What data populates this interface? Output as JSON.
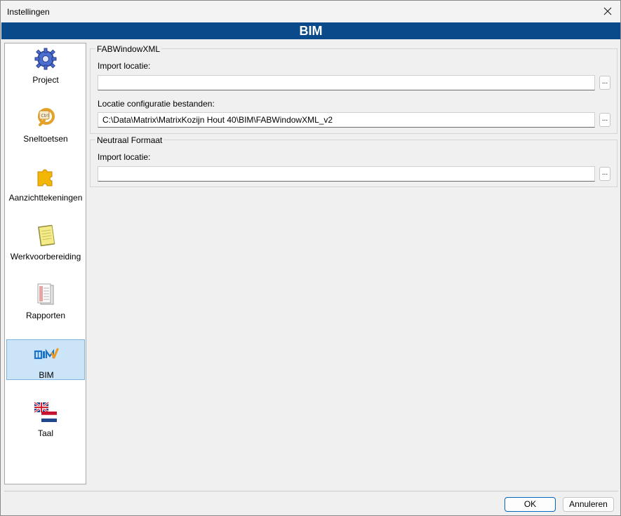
{
  "window": {
    "title": "Instellingen"
  },
  "banner": {
    "title": "BIM"
  },
  "sidebar": {
    "items": [
      {
        "label": "Project",
        "icon": "gear-icon"
      },
      {
        "label": "Sneltoetsen",
        "icon": "keyboard-key-icon"
      },
      {
        "label": "Aanzichttekeningen",
        "icon": "puzzle-icon"
      },
      {
        "label": "Werkvoorbereiding",
        "icon": "notepad-icon"
      },
      {
        "label": "Rapporten",
        "icon": "report-icon"
      },
      {
        "label": "BIM",
        "icon": "bim-logo-icon",
        "selected": true
      },
      {
        "label": "Taal",
        "icon": "flags-icon"
      }
    ]
  },
  "groups": {
    "fab": {
      "title": "FABWindowXML",
      "import_label": "Import locatie:",
      "import_value": "",
      "config_label": "Locatie configuratie bestanden:",
      "config_value": "C:\\Data\\Matrix\\MatrixKozijn Hout 40\\BIM\\FABWindowXML_v2"
    },
    "neutral": {
      "title": "Neutraal Formaat",
      "import_label": "Import locatie:",
      "import_value": ""
    }
  },
  "browse_label": "...",
  "footer": {
    "ok_label": "OK",
    "cancel_label": "Annuleren"
  },
  "colors": {
    "banner": "#0b4a8a",
    "selection": "#cce4f7"
  }
}
